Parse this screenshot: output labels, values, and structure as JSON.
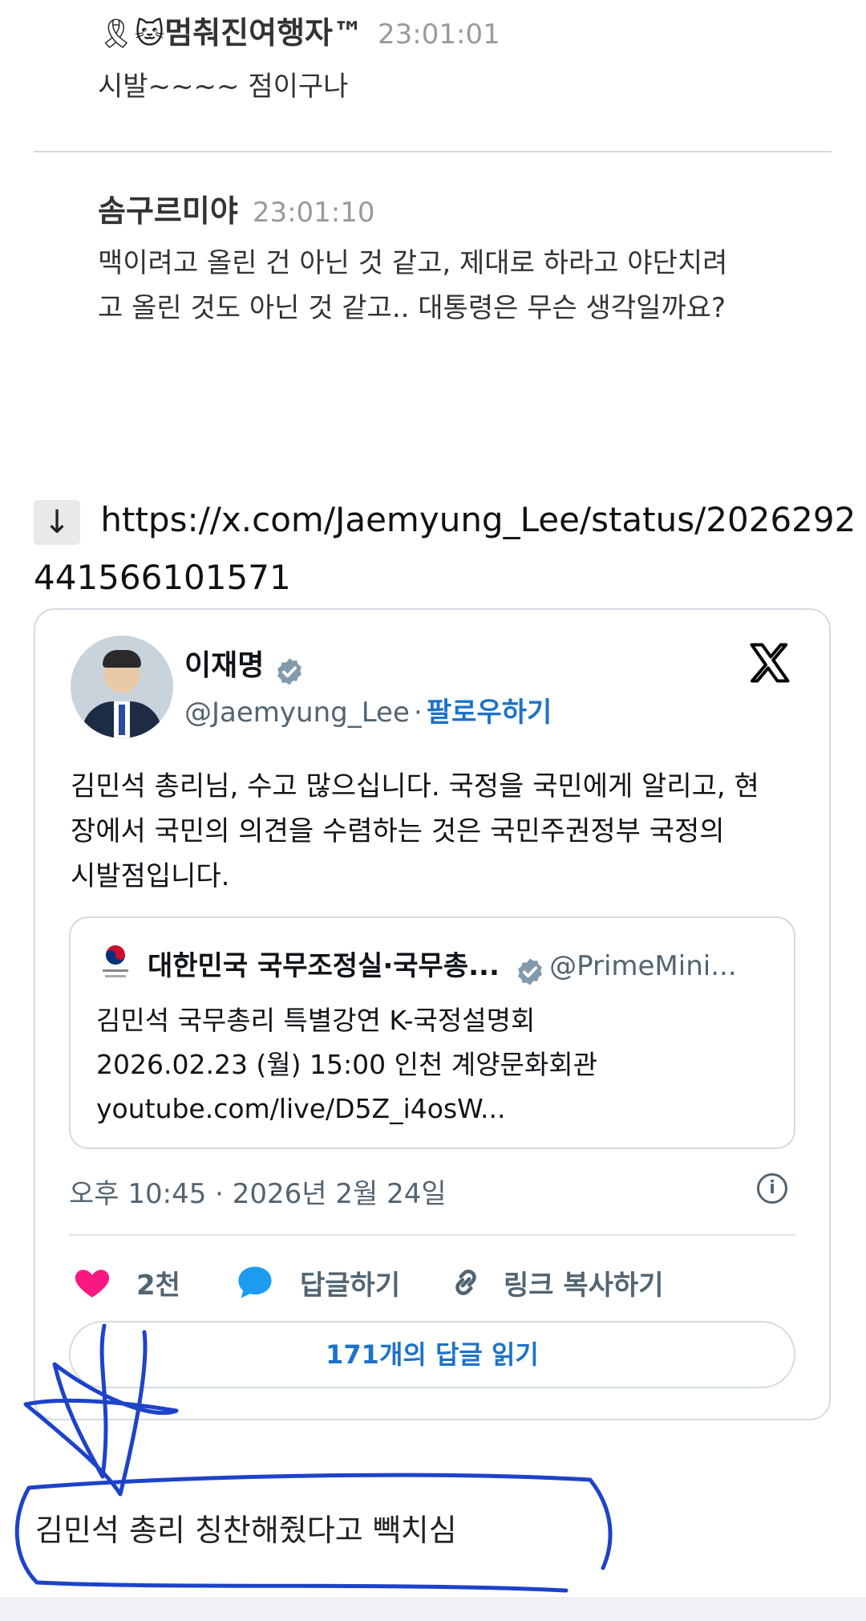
{
  "comments": [
    {
      "emoji_prefix": "🎗🐱",
      "author": "멈춰진여행자™",
      "time": "23:01:01",
      "body": "시발~~~~ 점이구나"
    },
    {
      "author": "솜구르미야",
      "time": "23:01:10",
      "body_lines": [
        "맥이려고 올린 건 아닌 것 같고, 제대로 하라고 야단치려",
        "고 올린 것도 아닌 것 같고.. 대통령은 무슨 생각일까요?"
      ]
    }
  ],
  "link": {
    "arrow": "↓",
    "url_line1": "https://x.com/Jaemyung_Lee/status/2026292",
    "url_line2": "441566101571"
  },
  "tweet": {
    "name": "이재명",
    "handle": "@Jaemyung_Lee",
    "separator": "·",
    "follow_label": "팔로우하기",
    "x_logo": "𝕏",
    "text_lines": [
      "김민석 총리님, 수고 많으십니다. 국정을 국민에게 알리고, 현",
      "장에서 국민의 의견을 수렴하는 것은 국민주권정부 국정의",
      "시발점입니다."
    ],
    "quote": {
      "name": "대한민국 국무조정실·국무총...",
      "handle": "@PrimeMini...",
      "lines": [
        "김민석 국무총리 특별강연 K-국정설명회",
        "2026.02.23 (월) 15:00 인천 계양문화회관",
        "youtube.com/live/D5Z_i4osW..."
      ]
    },
    "timestamp": "오후 10:45 · 2026년 2월 24일",
    "info_icon": "i",
    "actions": {
      "like_count": "2천",
      "reply_label": "답글하기",
      "copy_label": "링크 복사하기"
    },
    "read_replies_label": "171개의 답글 읽기"
  },
  "caption": "김민석 총리 칭찬해줬다고 빽치심",
  "colors": {
    "link_blue": "#1d73c7",
    "like_pink": "#f91880",
    "reply_blue": "#1d9bf0",
    "ink_blue": "#1d43c9"
  }
}
